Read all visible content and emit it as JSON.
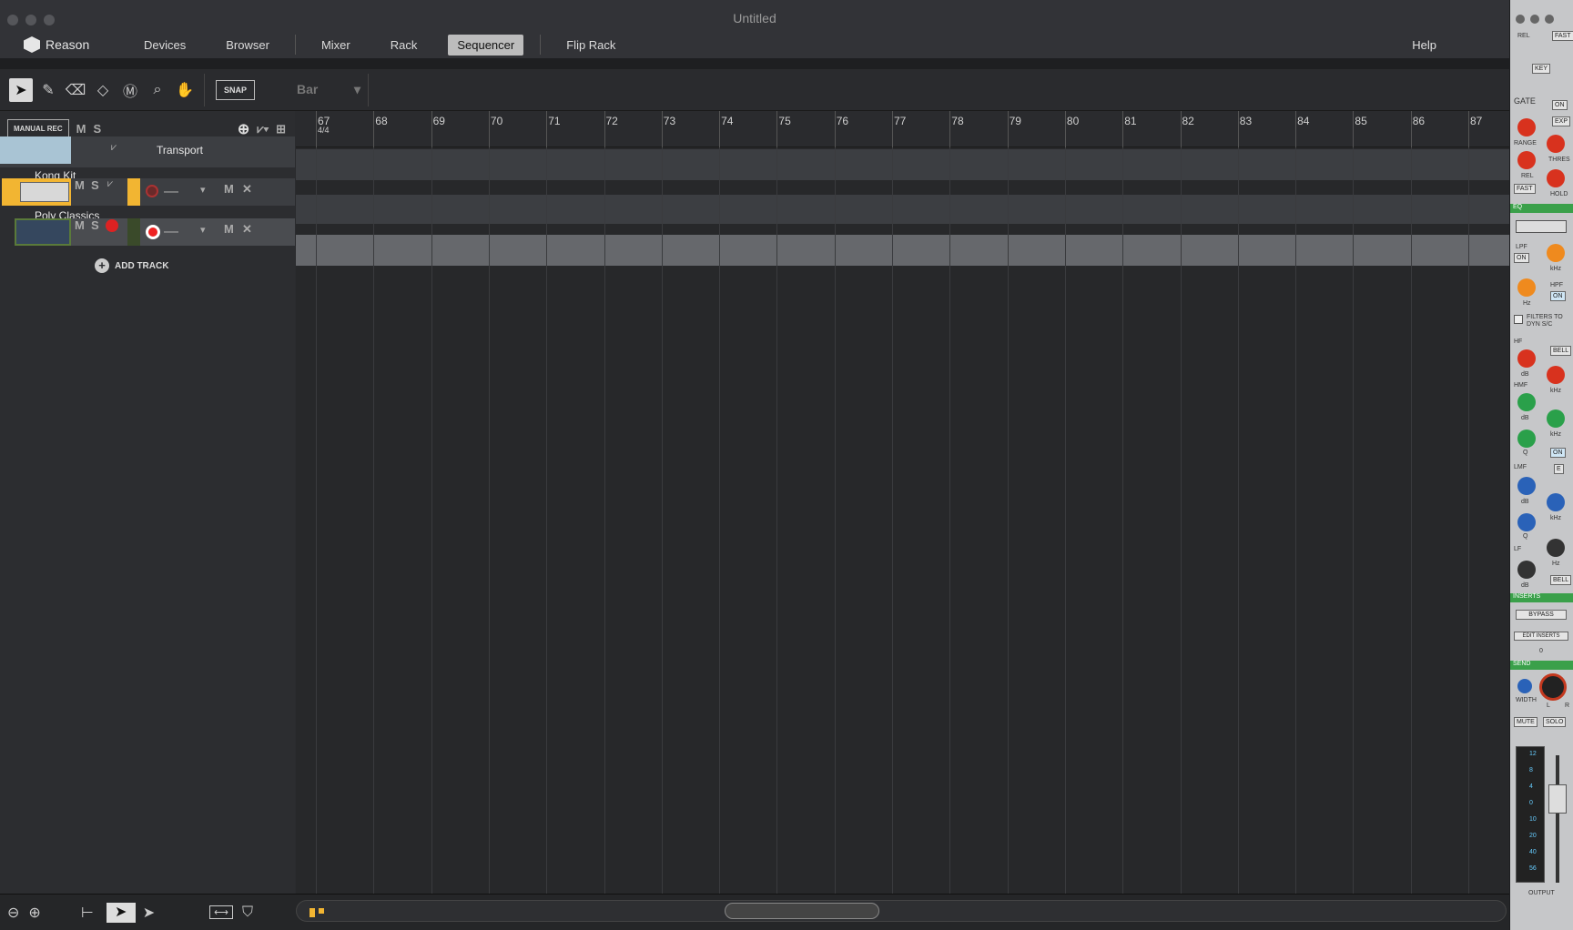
{
  "window": {
    "title": "Untitled"
  },
  "nav": {
    "app": "Reason",
    "items": [
      "Devices",
      "Browser",
      "Mixer",
      "Rack",
      "Sequencer",
      "Flip Rack"
    ],
    "active": "Sequencer",
    "help": "Help"
  },
  "toolbar": {
    "snap": "SNAP",
    "snap_value": "Bar",
    "manual_rec": "MANUAL REC",
    "mute": "M",
    "solo": "S"
  },
  "ruler": {
    "bars": [
      "67",
      "68",
      "69",
      "70",
      "71",
      "72",
      "73",
      "74",
      "75",
      "76",
      "77",
      "78",
      "79",
      "80",
      "81",
      "82",
      "83",
      "84",
      "85",
      "86",
      "87"
    ],
    "signature": "4/4"
  },
  "tracks": [
    {
      "name": "Transport"
    },
    {
      "name": "Kong Kit",
      "m": "M",
      "s": "S",
      "lane_m": "M",
      "color": "#f2b532"
    },
    {
      "name": "Poly Classics",
      "m": "M",
      "s": "S",
      "lane_m": "M",
      "color": "#5a7a3a"
    }
  ],
  "add_track": "ADD TRACK",
  "rack_panel": {
    "labels": {
      "rel": "REL",
      "fast": "FAST",
      "key": "KEY",
      "gate": "GATE",
      "on": "ON",
      "exp": "EXP",
      "range": "RANGE",
      "thres": "THRES",
      "hold": "HOLD",
      "eq": "EQ",
      "lpf": "LPF",
      "hpf": "HPF",
      "khz": "kHz",
      "hz": "Hz",
      "filters": "FILTERS TO DYN S/C",
      "hf": "HF",
      "bell": "BELL",
      "db": "dB",
      "hmf": "HMF",
      "q": "Q",
      "lmf": "LMF",
      "e": "E",
      "lf": "LF",
      "inserts": "INSERTS",
      "bypass": "BYPASS",
      "edit_inserts": "EDIT INSERTS",
      "zero": "0",
      "send": "SEND",
      "width": "WIDTH",
      "l": "L",
      "r": "R",
      "mute": "MUTE",
      "solo": "SOLO",
      "output": "OUTPUT"
    },
    "meter_scale": [
      "12",
      "8",
      "4",
      "0",
      "10",
      "20",
      "40",
      "56"
    ]
  }
}
